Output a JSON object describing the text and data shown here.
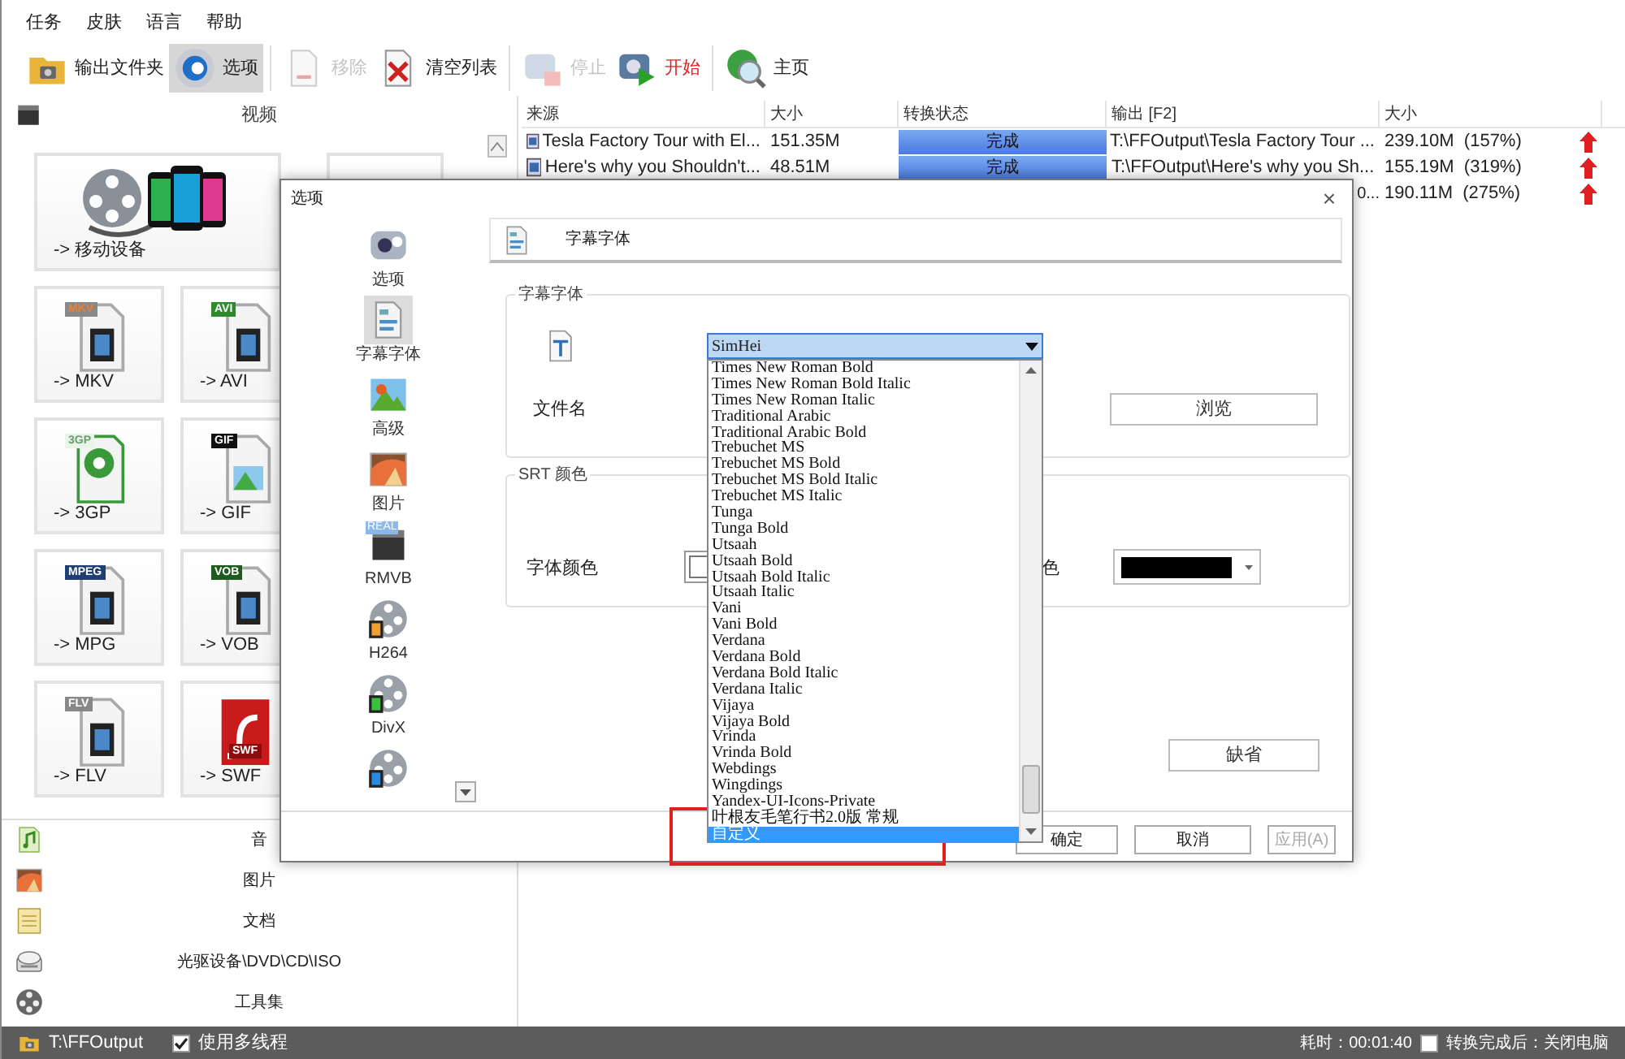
{
  "menu": [
    "任务",
    "皮肤",
    "语言",
    "帮助"
  ],
  "toolbar": [
    {
      "label": "输出文件夹",
      "kind": "folder",
      "disabled": false,
      "selected": false
    },
    {
      "label": "选项",
      "kind": "gear",
      "disabled": false,
      "selected": true
    },
    {
      "label": "移除",
      "kind": "remove",
      "disabled": true,
      "selected": false
    },
    {
      "label": "清空列表",
      "kind": "clear",
      "disabled": false,
      "selected": false
    },
    {
      "label": "停止",
      "kind": "stop",
      "disabled": true,
      "selected": false
    },
    {
      "label": "开始",
      "kind": "start",
      "disabled": false,
      "selected": false
    },
    {
      "label": "主页",
      "kind": "home",
      "disabled": false,
      "selected": false
    }
  ],
  "sidebar": {
    "header": "视频",
    "tiles": [
      {
        "label": "-> 移动设备",
        "kind": "mobile"
      },
      {
        "label": "-> MKV",
        "kind": "mkv",
        "badge": "MKV"
      },
      {
        "label": "-> AVI",
        "kind": "avi",
        "badge": "AVI"
      },
      {
        "label": "-> 3GP",
        "kind": "threegp",
        "badge": "3GP"
      },
      {
        "label": "-> GIF",
        "kind": "gif",
        "badge": "GIF"
      },
      {
        "label": "-> MPG",
        "kind": "mpg",
        "badge": "MPEG"
      },
      {
        "label": "-> VOB",
        "kind": "vob",
        "badge": "VOB"
      },
      {
        "label": "-> FLV",
        "kind": "flv",
        "badge": "FLV"
      },
      {
        "label": "-> SWF",
        "kind": "swf",
        "badge": "SWF"
      }
    ],
    "categories": [
      {
        "label": "音",
        "kind": "audio"
      },
      {
        "label": "图片",
        "kind": "picture"
      },
      {
        "label": "文档",
        "kind": "document"
      },
      {
        "label": "光驱设备\\DVD\\CD\\ISO",
        "kind": "disc"
      },
      {
        "label": "工具集",
        "kind": "tools"
      }
    ]
  },
  "table": {
    "columns": [
      "来源",
      "大小",
      "转换状态",
      "输出 [F2]",
      "大小"
    ],
    "rows": [
      {
        "source": "Tesla Factory Tour with El...",
        "size": "151.35M",
        "status": "完成",
        "output": "T:\\FFOutput\\Tesla Factory Tour ...",
        "out_size": "239.10M  (157%)"
      },
      {
        "source": "Here's why you Shouldn't...",
        "size": "48.51M",
        "status": "完成",
        "output": "T:\\FFOutput\\Here's why you Sh...",
        "out_size": "155.19M  (319%)"
      },
      {
        "output": "0...",
        "out_size": "190.11M  (275%)"
      }
    ]
  },
  "dialog": {
    "title": "选项",
    "close": "×",
    "nav": [
      {
        "label": "选项",
        "kind": "options",
        "selected": false
      },
      {
        "label": "字幕字体",
        "kind": "subtitle",
        "selected": true
      },
      {
        "label": "高级",
        "kind": "advanced",
        "selected": false
      },
      {
        "label": "图片",
        "kind": "picture",
        "selected": false
      },
      {
        "label": "RMVB",
        "kind": "rmvb",
        "selected": false,
        "badge": "REAL"
      },
      {
        "label": "H264",
        "kind": "h264",
        "selected": false
      },
      {
        "label": "DivX",
        "kind": "divx",
        "selected": false
      },
      {
        "kind": "more",
        "selected": false
      }
    ],
    "header": "字幕字体",
    "font_group": {
      "title": "字幕字体",
      "file_label": "文件名",
      "browse": "浏览",
      "font_select": {
        "value": "SimHei",
        "expanded": true,
        "options": [
          {
            "label": "Times New Roman Bold",
            "selected": false
          },
          {
            "label": "Times New Roman Bold Italic",
            "selected": false
          },
          {
            "label": "Times New Roman Italic",
            "selected": false
          },
          {
            "label": "Traditional Arabic",
            "selected": false
          },
          {
            "label": "Traditional Arabic Bold",
            "selected": false
          },
          {
            "label": "Trebuchet MS",
            "selected": false
          },
          {
            "label": "Trebuchet MS Bold",
            "selected": false
          },
          {
            "label": "Trebuchet MS Bold Italic",
            "selected": false
          },
          {
            "label": "Trebuchet MS Italic",
            "selected": false
          },
          {
            "label": "Tunga",
            "selected": false
          },
          {
            "label": "Tunga Bold",
            "selected": false
          },
          {
            "label": "Utsaah",
            "selected": false
          },
          {
            "label": "Utsaah Bold",
            "selected": false
          },
          {
            "label": "Utsaah Bold Italic",
            "selected": false
          },
          {
            "label": "Utsaah Italic",
            "selected": false
          },
          {
            "label": "Vani",
            "selected": false
          },
          {
            "label": "Vani Bold",
            "selected": false
          },
          {
            "label": "Verdana",
            "selected": false
          },
          {
            "label": "Verdana Bold",
            "selected": false
          },
          {
            "label": "Verdana Bold Italic",
            "selected": false
          },
          {
            "label": "Verdana Italic",
            "selected": false
          },
          {
            "label": "Vijaya",
            "selected": false
          },
          {
            "label": "Vijaya Bold",
            "selected": false
          },
          {
            "label": "Vrinda",
            "selected": false
          },
          {
            "label": "Vrinda Bold",
            "selected": false
          },
          {
            "label": "Webdings",
            "selected": false
          },
          {
            "label": "Wingdings",
            "selected": false
          },
          {
            "label": "Yandex-UI-Icons-Private",
            "selected": false
          },
          {
            "label": "叶根友毛笔行书2.0版 常规",
            "selected": false
          },
          {
            "label": "自定义",
            "selected": true
          }
        ]
      }
    },
    "color_group": {
      "title": "SRT 颜色",
      "font_color": {
        "label": "字体颜色",
        "color": "#ffffff"
      },
      "bg_color": {
        "label": "色",
        "color": "#000000"
      }
    },
    "default_button": "缺省",
    "buttons": [
      {
        "label": "确定",
        "disabled": false
      },
      {
        "label": "取消",
        "disabled": false
      },
      {
        "label": "应用(A)",
        "disabled": true
      }
    ]
  },
  "status_bar": {
    "folder": "T:\\FFOutput",
    "multithread": {
      "label": "使用多线程",
      "checked": true
    },
    "elapsed": "耗时：00:01:40",
    "shutdown": {
      "label": "转换完成后：关闭电脑",
      "checked": false
    }
  }
}
